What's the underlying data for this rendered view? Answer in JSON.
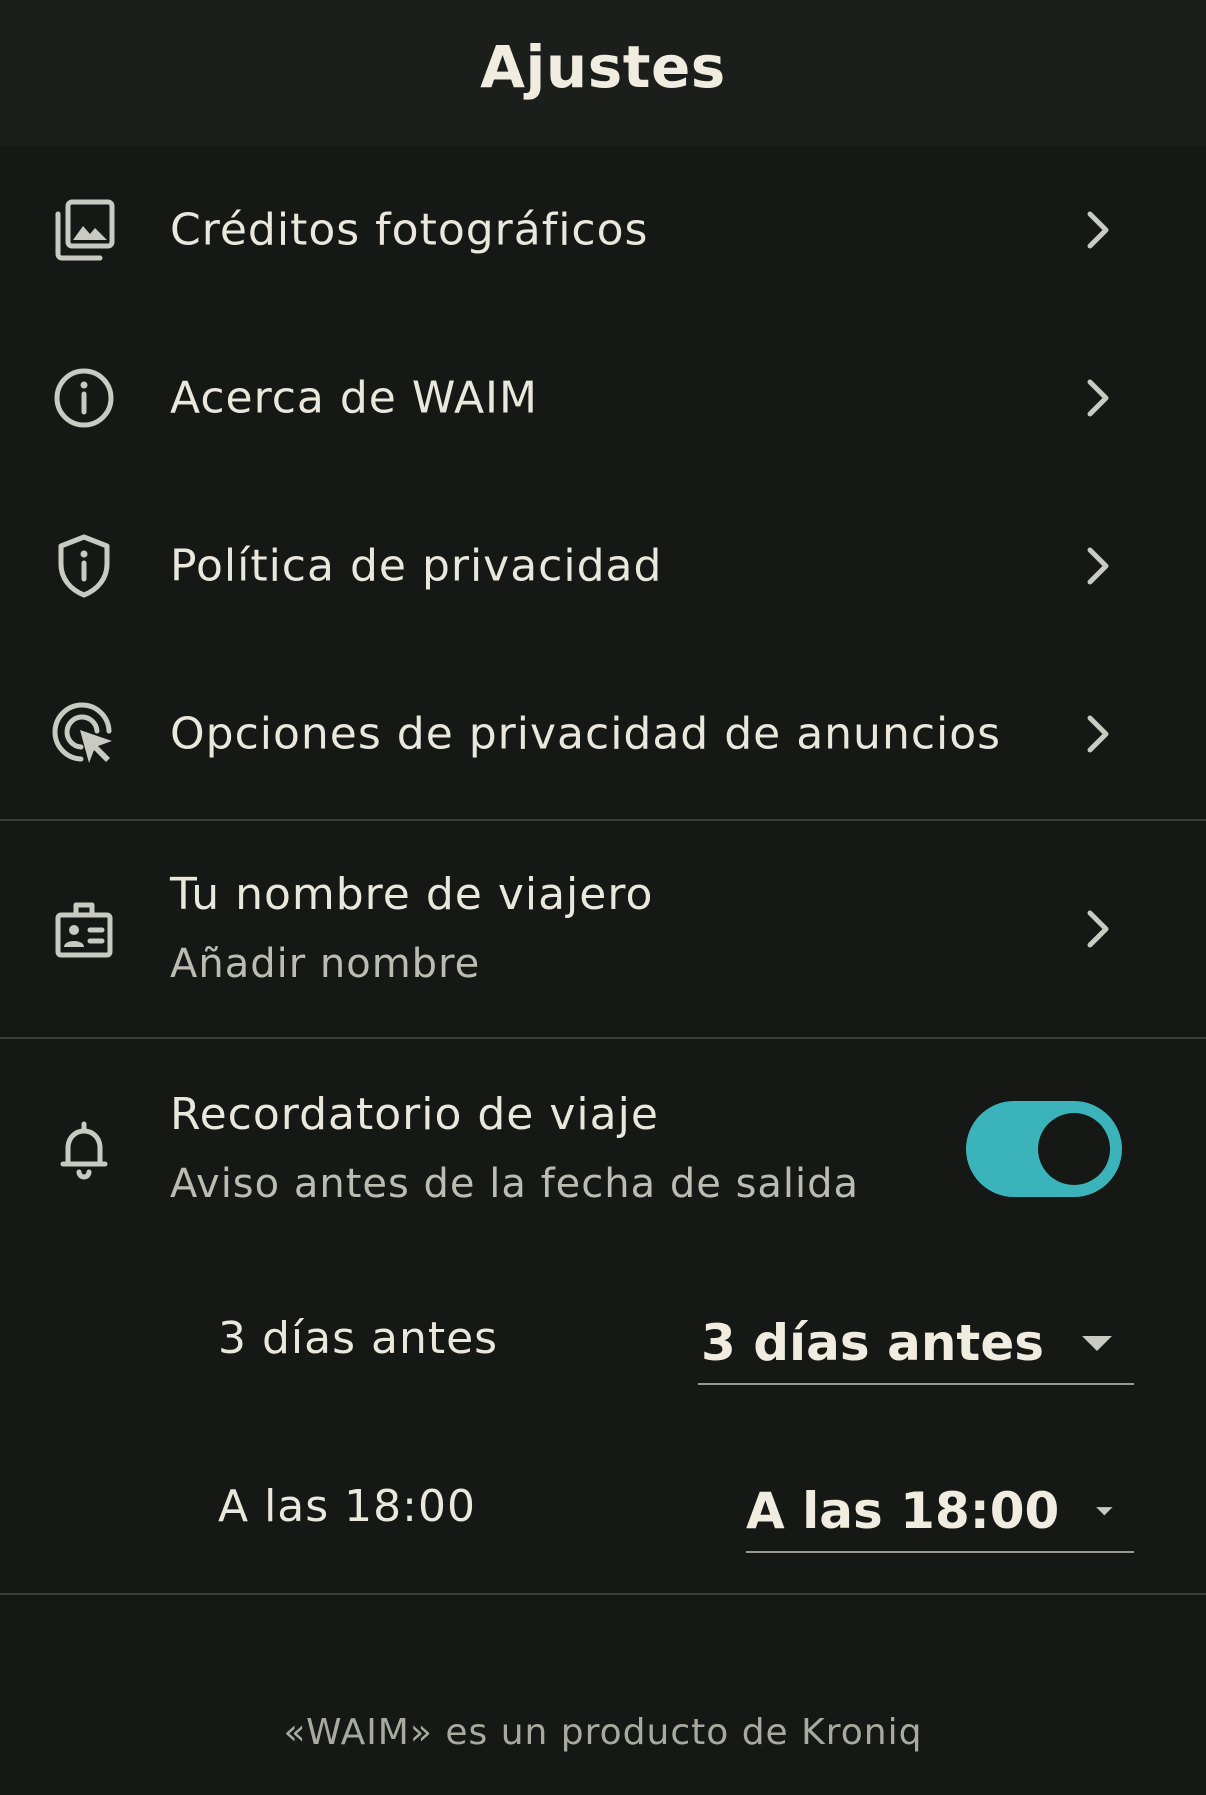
{
  "header": {
    "title": "Ajustes"
  },
  "menu": {
    "items": [
      {
        "label": "Créditos fotográficos",
        "icon": "photo-library-icon"
      },
      {
        "label": "Acerca de WAIM",
        "icon": "info-icon"
      },
      {
        "label": "Política de privacidad",
        "icon": "shield-info-icon"
      },
      {
        "label": "Opciones de privacidad de anuncios",
        "icon": "ad-click-icon"
      }
    ]
  },
  "traveler": {
    "title": "Tu nombre de viajero",
    "subtitle": "Añadir nombre",
    "icon": "badge-icon"
  },
  "reminder": {
    "title": "Recordatorio de viaje",
    "subtitle": "Aviso antes de la fecha de salida",
    "enabled": true,
    "icon": "bell-icon",
    "days_label": "3 días antes",
    "days_value": "3 días antes",
    "time_label": "A las 18:00",
    "time_value": "A las 18:00"
  },
  "footer": {
    "text": "«WAIM» es un producto de Kroniq"
  },
  "colors": {
    "background": "#151815",
    "header": "#1b1e1a",
    "accent": "#3bb3bb",
    "text": "#eae7dc"
  }
}
